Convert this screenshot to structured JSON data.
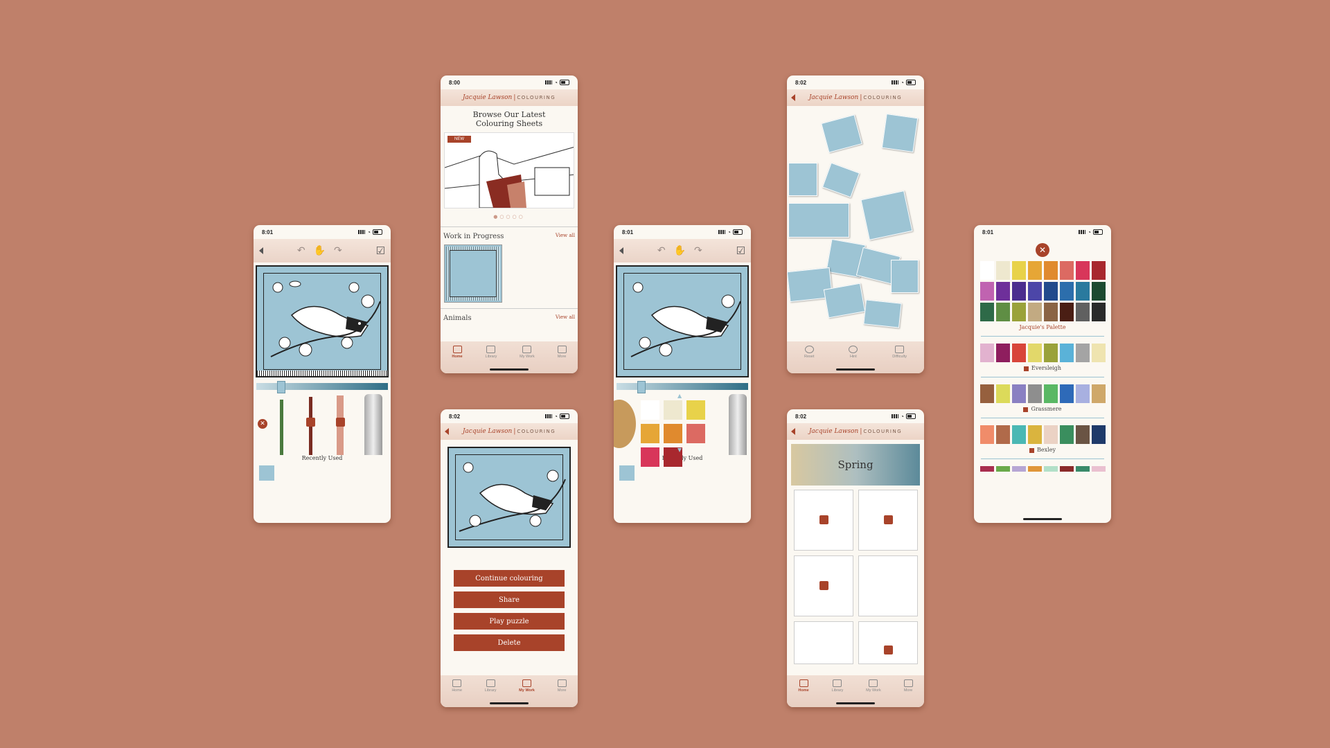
{
  "status": {
    "time_801": "8:01",
    "time_800": "8:00",
    "time_802": "8:02"
  },
  "brand": {
    "script": "Jacquie Lawson",
    "separator": "|",
    "word": "COLOURING"
  },
  "home": {
    "browse_title": "Browse Our Latest Colouring Sheets",
    "new_badge": "NEW",
    "wip_title": "Work in Progress",
    "view_all": "View all",
    "animals_title": "Animals"
  },
  "tabs": {
    "home": "Home",
    "library": "Library",
    "my_work": "My Work",
    "more": "More"
  },
  "editor": {
    "recently_used": "Recently Used"
  },
  "artwork_actions": {
    "continue": "Continue colouring",
    "share": "Share",
    "play_puzzle": "Play puzzle",
    "delete": "Delete"
  },
  "puzzle": {
    "reset": "Reset",
    "hint": "Hint",
    "difficulty": "Difficulty"
  },
  "library": {
    "banner": "Spring"
  },
  "palettes": {
    "main_name": "Jacquie's Palette",
    "main_colors": [
      "#ffffff",
      "#eee8cf",
      "#e8d24a",
      "#e6a636",
      "#e08a2e",
      "#dc6a62",
      "#d8365a",
      "#a8282e",
      "#c063b0",
      "#6e2f9a",
      "#4b2e8e",
      "#4c46a8",
      "#224a8c",
      "#2c6eac",
      "#2a7a9e",
      "#1c4a30",
      "#2e6a48",
      "#5f8e44",
      "#9aa23a",
      "#c2aa82",
      "#8a6444",
      "#4a1e14",
      "#606060",
      "#2a2a2a"
    ],
    "items": [
      {
        "name": "Eversleigh",
        "colors": [
          "#e2b2cf",
          "#8e1e5e",
          "#d8453a",
          "#e2d86a",
          "#9aa23a",
          "#5ab2d8",
          "#a4a4a4",
          "#efe4b0"
        ]
      },
      {
        "name": "Grassmere",
        "colors": [
          "#96603e",
          "#dcda5a",
          "#8a80c2",
          "#8e8e8e",
          "#5ab864",
          "#2e6ab8",
          "#a8b0e0",
          "#cfa86a"
        ]
      },
      {
        "name": "Bexley",
        "colors": [
          "#f08c6a",
          "#b06a4a",
          "#4ab8b4",
          "#dab43e",
          "#ebd2c4",
          "#3a8e5e",
          "#6a5444",
          "#1e3a6a"
        ]
      }
    ],
    "last_row": [
      "#a82e4e",
      "#6aaa4a",
      "#b6a6d4",
      "#e0963a",
      "#b2e0c8",
      "#8a2a2a",
      "#3a8a6a",
      "#eac0d0"
    ]
  },
  "colours": {
    "accent": "#a8432a",
    "background": "#bf806a",
    "sky_blue": "#9dc4d4"
  }
}
